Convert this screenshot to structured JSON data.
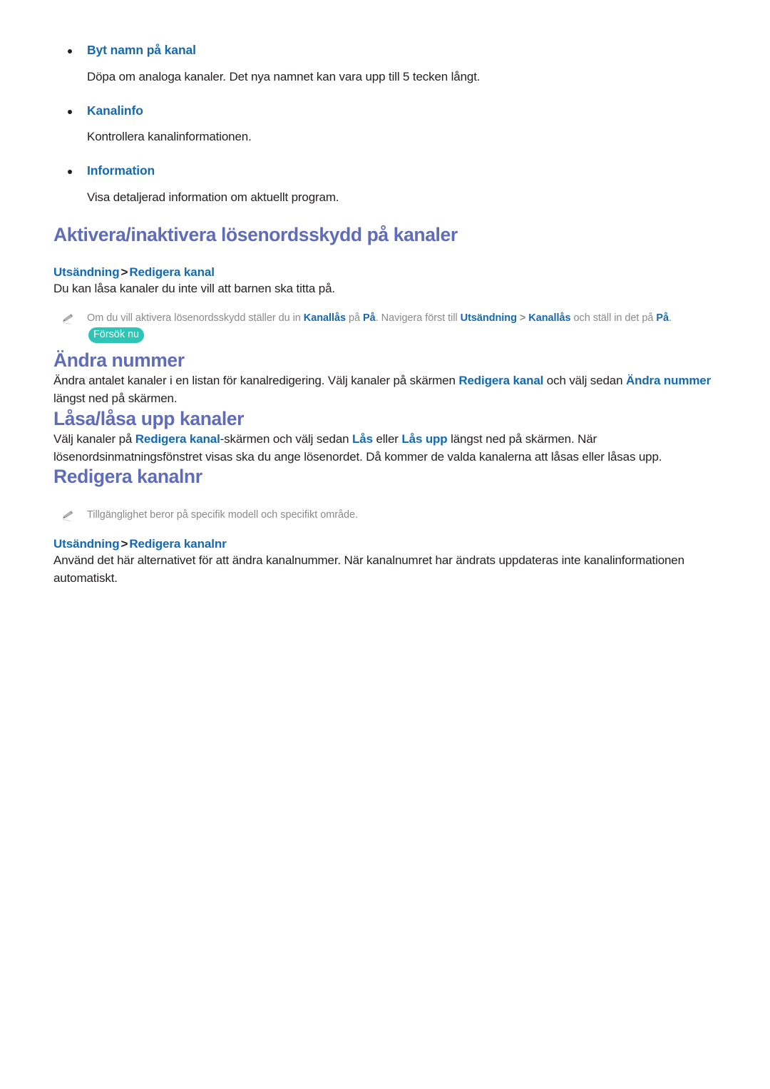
{
  "document": {
    "language": "sv",
    "colors": {
      "section_heading": "#5f6cb8",
      "link_blue": "#1569b0",
      "body_text": "#231f20",
      "note_gray": "#8a8a8a",
      "badge_teal": "#2ec4b6",
      "page_background": "#ffffff"
    }
  },
  "bullets": [
    {
      "label": "Byt namn på kanal",
      "description": "Döpa om analoga kanaler. Det nya namnet kan vara upp till 5 tecken långt."
    },
    {
      "label": "Kanalinfo",
      "description": "Kontrollera kanalinformationen."
    },
    {
      "label": "Information",
      "description": "Visa detaljerad information om aktuellt program."
    }
  ],
  "sections": [
    {
      "title": "Aktivera/inaktivera lösenordsskydd på kanaler",
      "path": {
        "first": "Utsändning",
        "separator": ">",
        "second": "Redigera kanal"
      },
      "body": "Du kan låsa kanaler du inte vill att barnen ska titta på.",
      "note": {
        "icon": "pencil-icon",
        "part1": "Om du vill aktivera lösenordsskydd ställer du in ",
        "bold1": "Kanallås",
        "part2": " på ",
        "bold2": "På",
        "part3": ". Navigera först till ",
        "bold3": "Utsändning",
        "separator": " > ",
        "bold4": "Kanallås",
        "part4": " och ställ in det på ",
        "bold5": "På",
        "part5": ".",
        "badge": "Försök nu"
      }
    },
    {
      "title": "Ändra nummer",
      "body_part1": "Ändra antalet kanaler i en listan för kanalredigering. Välj kanaler på skärmen ",
      "body_bold1": "Redigera kanal",
      "body_part2": " och välj sedan ",
      "body_bold2": "Ändra nummer",
      "body_part3": " längst ned på skärmen."
    },
    {
      "title": "Låsa/låsa upp kanaler",
      "body_part1": "Välj kanaler på ",
      "body_bold1": "Redigera kanal",
      "body_part2": "-skärmen och välj sedan ",
      "body_bold2": "Lås",
      "body_part3": " eller ",
      "body_bold3": "Lås upp",
      "body_part4": " längst ned på skärmen. När lösenordsinmatningsfönstret visas ska du ange lösenordet. Då kommer de valda kanalerna att låsas eller låsas upp."
    },
    {
      "title": "Redigera kanalnr",
      "note": {
        "icon": "pencil-icon",
        "text": "Tillgänglighet beror på specifik modell och specifikt område."
      },
      "path": {
        "first": "Utsändning",
        "separator": ">",
        "second": "Redigera kanalnr"
      },
      "body": "Använd det här alternativet för att ändra kanalnummer. När kanalnumret har ändrats uppdateras inte kanalinformationen automatiskt."
    }
  ]
}
